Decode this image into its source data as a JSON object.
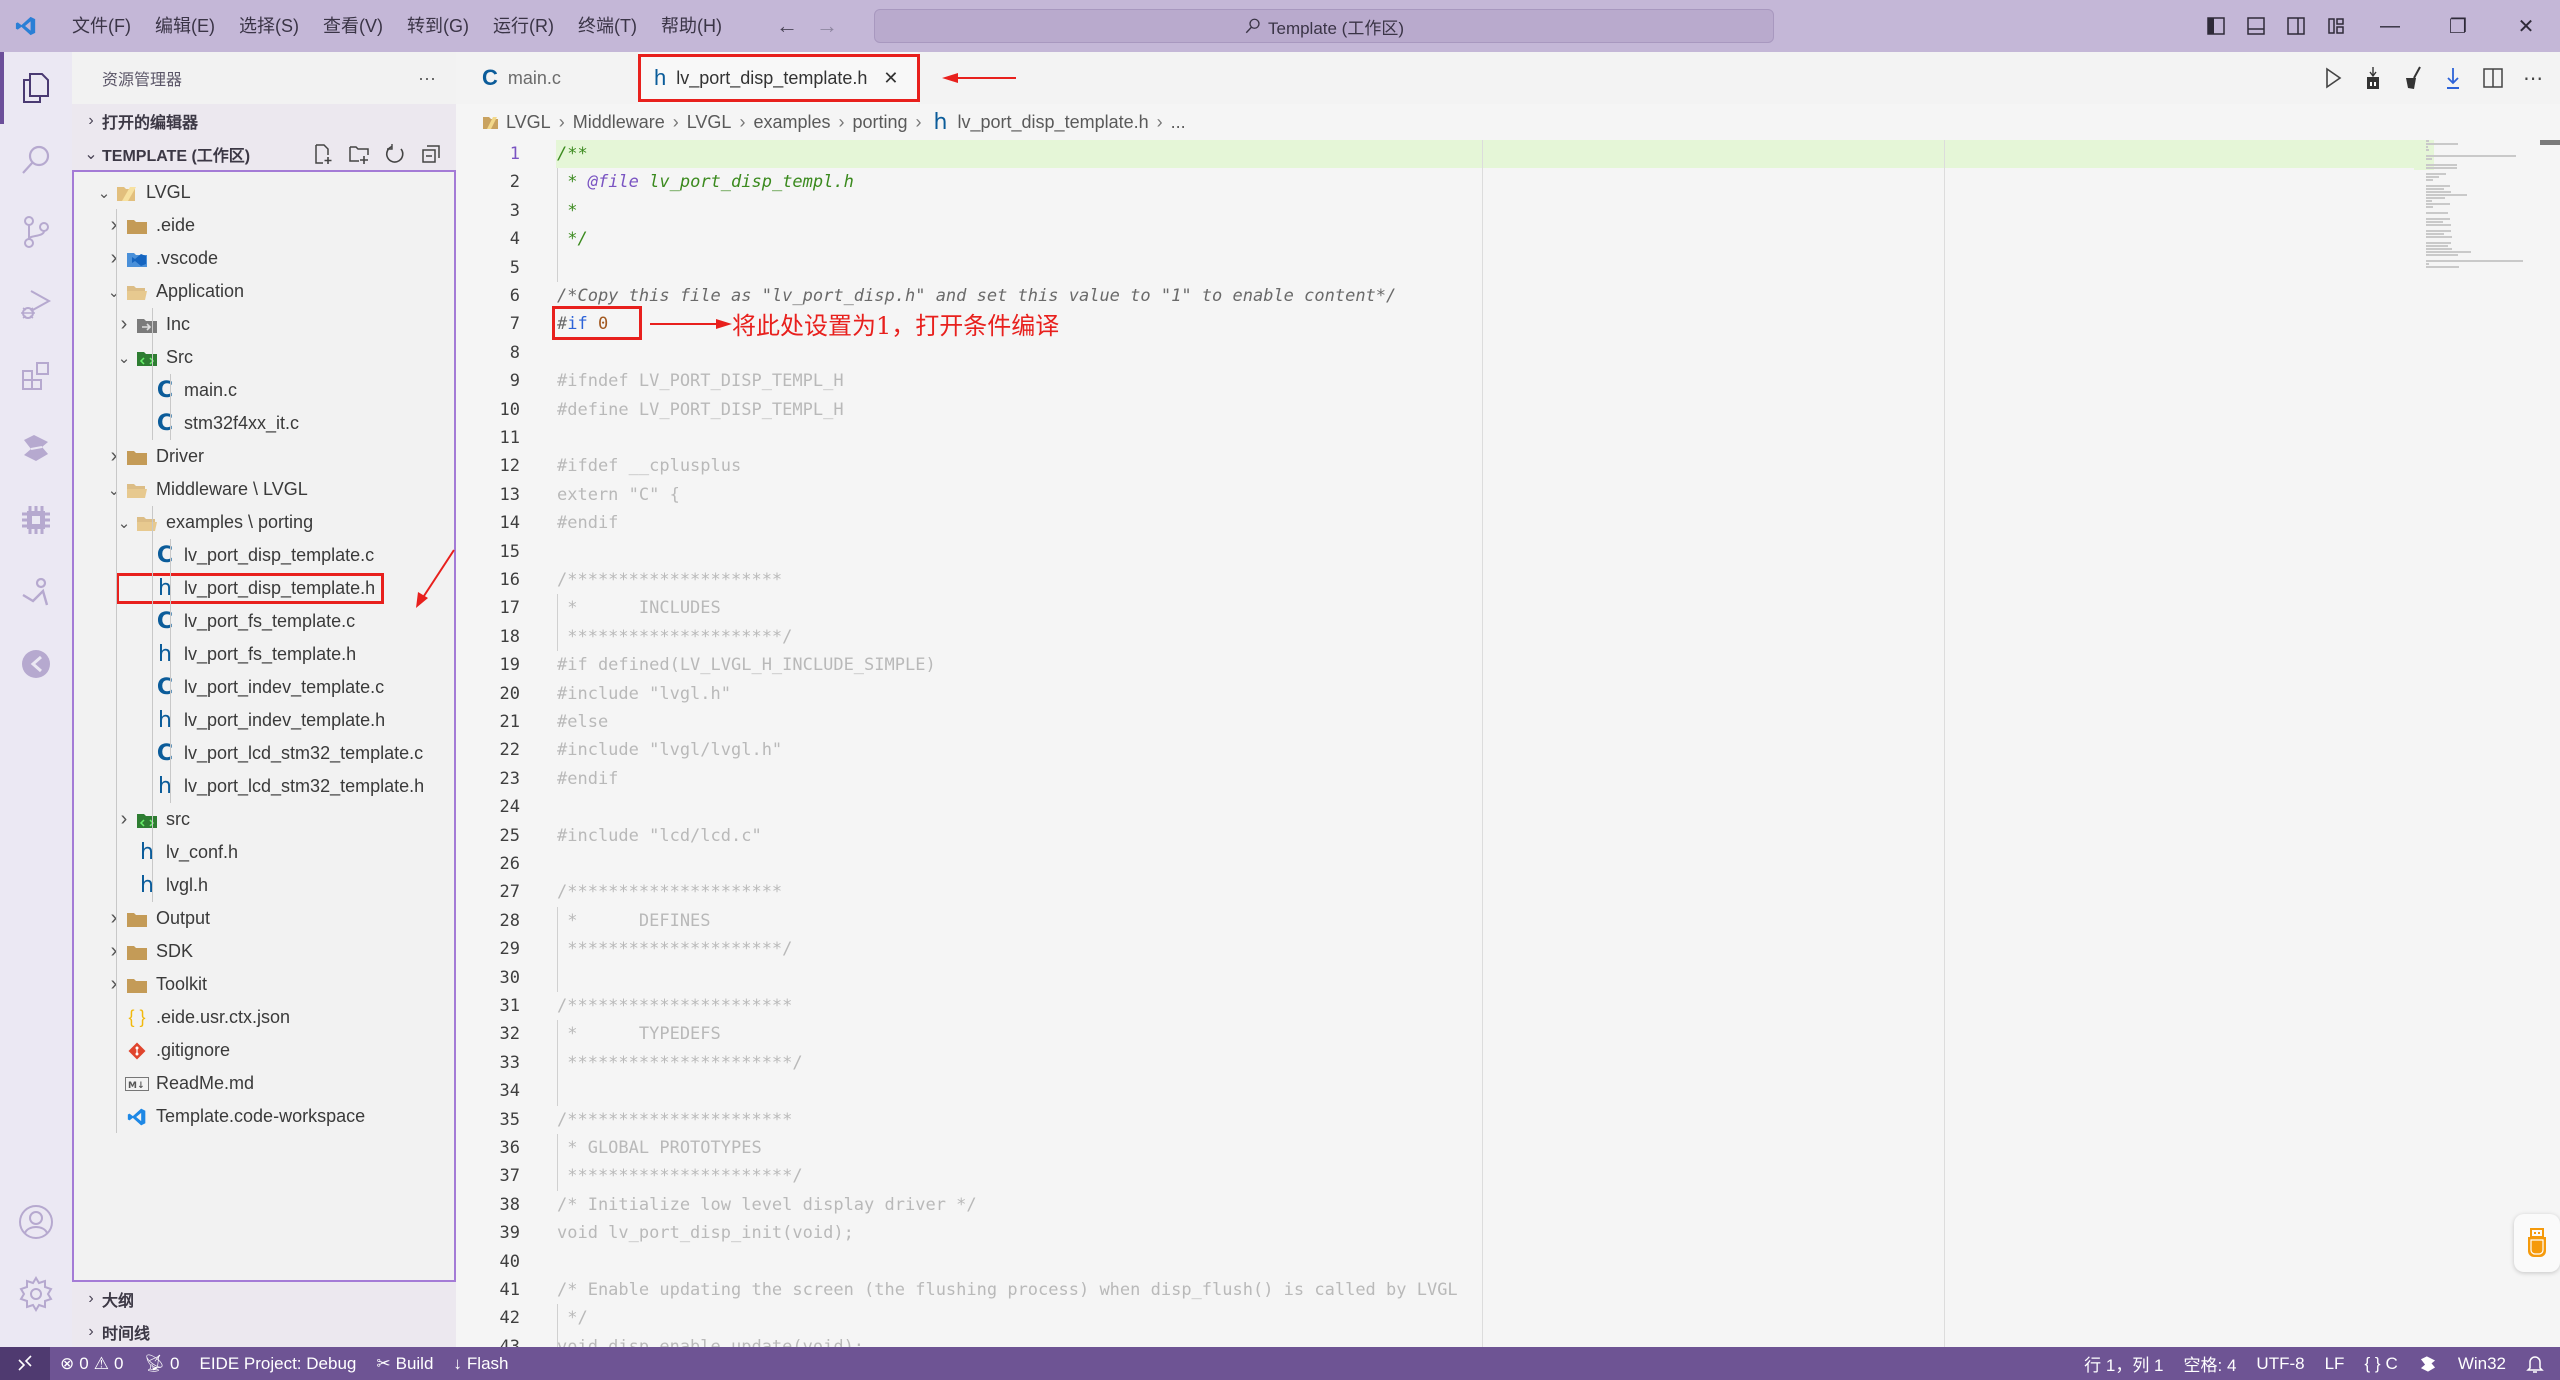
{
  "titlebar": {
    "menu": [
      "文件(F)",
      "编辑(E)",
      "选择(S)",
      "查看(V)",
      "转到(G)",
      "运行(R)",
      "终端(T)",
      "帮助(H)"
    ],
    "command_center": "Template (工作区)",
    "back_glyph": "←",
    "forward_glyph": "→",
    "minimize_glyph": "—",
    "restore_glyph": "❐",
    "close_glyph": "✕"
  },
  "activity_bar": {
    "items": [
      "explorer",
      "search",
      "source-control",
      "run-and-debug",
      "extensions",
      "eide",
      "chip",
      "remote-explorer",
      "codegeex"
    ],
    "bottom": [
      "accounts",
      "manage"
    ]
  },
  "sidebar": {
    "title": "资源管理器",
    "more": "···",
    "open_editors": "打开的编辑器",
    "workspace": "TEMPLATE (工作区)",
    "outline": "大纲",
    "timeline": "时间线",
    "tree": [
      {
        "label": "LVGL",
        "depth": 0,
        "twist": "open",
        "icon": "folder-root"
      },
      {
        "label": ".eide",
        "depth": 1,
        "twist": "closed",
        "icon": "folder"
      },
      {
        "label": ".vscode",
        "depth": 1,
        "twist": "closed",
        "icon": "folder-vscode"
      },
      {
        "label": "Application",
        "depth": 1,
        "twist": "open",
        "icon": "folder-open"
      },
      {
        "label": "Inc",
        "depth": 2,
        "twist": "closed",
        "icon": "folder-include"
      },
      {
        "label": "Src",
        "depth": 2,
        "twist": "open",
        "icon": "folder-src"
      },
      {
        "label": "main.c",
        "depth": 3,
        "twist": "none",
        "icon": "c"
      },
      {
        "label": "stm32f4xx_it.c",
        "depth": 3,
        "twist": "none",
        "icon": "c"
      },
      {
        "label": "Driver",
        "depth": 1,
        "twist": "closed",
        "icon": "folder"
      },
      {
        "label": "Middleware \\ LVGL",
        "depth": 1,
        "twist": "open",
        "icon": "folder-open"
      },
      {
        "label": "examples \\ porting",
        "depth": 2,
        "twist": "open",
        "icon": "folder-open"
      },
      {
        "label": "lv_port_disp_template.c",
        "depth": 3,
        "twist": "none",
        "icon": "c"
      },
      {
        "label": "lv_port_disp_template.h",
        "depth": 3,
        "twist": "none",
        "icon": "h",
        "selected": true
      },
      {
        "label": "lv_port_fs_template.c",
        "depth": 3,
        "twist": "none",
        "icon": "c"
      },
      {
        "label": "lv_port_fs_template.h",
        "depth": 3,
        "twist": "none",
        "icon": "h"
      },
      {
        "label": "lv_port_indev_template.c",
        "depth": 3,
        "twist": "none",
        "icon": "c"
      },
      {
        "label": "lv_port_indev_template.h",
        "depth": 3,
        "twist": "none",
        "icon": "h"
      },
      {
        "label": "lv_port_lcd_stm32_template.c",
        "depth": 3,
        "twist": "none",
        "icon": "c"
      },
      {
        "label": "lv_port_lcd_stm32_template.h",
        "depth": 3,
        "twist": "none",
        "icon": "h"
      },
      {
        "label": "src",
        "depth": 2,
        "twist": "closed",
        "icon": "folder-src"
      },
      {
        "label": "lv_conf.h",
        "depth": 2,
        "twist": "none",
        "icon": "h"
      },
      {
        "label": "lvgl.h",
        "depth": 2,
        "twist": "none",
        "icon": "h"
      },
      {
        "label": "Output",
        "depth": 1,
        "twist": "closed",
        "icon": "folder"
      },
      {
        "label": "SDK",
        "depth": 1,
        "twist": "closed",
        "icon": "folder"
      },
      {
        "label": "Toolkit",
        "depth": 1,
        "twist": "closed",
        "icon": "folder"
      },
      {
        "label": ".eide.usr.ctx.json",
        "depth": 1,
        "twist": "none",
        "icon": "json"
      },
      {
        "label": ".gitignore",
        "depth": 1,
        "twist": "none",
        "icon": "git"
      },
      {
        "label": "ReadMe.md",
        "depth": 1,
        "twist": "none",
        "icon": "markdown"
      },
      {
        "label": "Template.code-workspace",
        "depth": 1,
        "twist": "none",
        "icon": "vscode"
      }
    ]
  },
  "tabs": [
    {
      "label": "main.c",
      "icon": "C",
      "active": false
    },
    {
      "label": "lv_port_disp_template.h",
      "icon": "h",
      "active": true,
      "close": "✕"
    }
  ],
  "breadcrumb": [
    "LVGL",
    "Middleware",
    "LVGL",
    "examples",
    "porting",
    "lv_port_disp_template.h",
    "..."
  ],
  "breadcrumb_sep": "›",
  "editor": {
    "current_line": 1,
    "lines": [
      {
        "n": 1,
        "segs": [
          {
            "t": "/**",
            "c": "c-green"
          }
        ]
      },
      {
        "n": 2,
        "segs": [
          {
            "t": " * ",
            "c": "c-green"
          },
          {
            "t": "@file",
            "c": "c-tag"
          },
          {
            "t": " lv_port_disp_templ.h",
            "c": "c-green"
          }
        ]
      },
      {
        "n": 3,
        "segs": [
          {
            "t": " *",
            "c": "c-green"
          }
        ]
      },
      {
        "n": 4,
        "segs": [
          {
            "t": " */",
            "c": "c-green"
          }
        ]
      },
      {
        "n": 5,
        "segs": []
      },
      {
        "n": 6,
        "segs": [
          {
            "t": "/*Copy this file as \"lv_port_disp.h\" and set this value to \"1\" to enable content*/",
            "c": "c-comment"
          }
        ]
      },
      {
        "n": 7,
        "segs": [
          {
            "t": "#",
            "c": "c-comment"
          },
          {
            "t": "if",
            "c": "c-kw"
          },
          {
            "t": " ",
            "c": "c-dim"
          },
          {
            "t": "0",
            "c": "c-num"
          }
        ]
      },
      {
        "n": 8,
        "segs": []
      },
      {
        "n": 9,
        "segs": [
          {
            "t": "#ifndef LV_PORT_DISP_TEMPL_H",
            "c": "c-dim"
          }
        ]
      },
      {
        "n": 10,
        "segs": [
          {
            "t": "#define LV_PORT_DISP_TEMPL_H",
            "c": "c-dim"
          }
        ]
      },
      {
        "n": 11,
        "segs": []
      },
      {
        "n": 12,
        "segs": [
          {
            "t": "#ifdef __cplusplus",
            "c": "c-dim"
          }
        ]
      },
      {
        "n": 13,
        "segs": [
          {
            "t": "extern \"C\" {",
            "c": "c-dim"
          }
        ]
      },
      {
        "n": 14,
        "segs": [
          {
            "t": "#endif",
            "c": "c-dim"
          }
        ]
      },
      {
        "n": 15,
        "segs": []
      },
      {
        "n": 16,
        "segs": [
          {
            "t": "/*********************",
            "c": "c-dim"
          }
        ]
      },
      {
        "n": 17,
        "segs": [
          {
            "t": " *      INCLUDES",
            "c": "c-dim"
          }
        ]
      },
      {
        "n": 18,
        "segs": [
          {
            "t": " *********************/",
            "c": "c-dim"
          }
        ]
      },
      {
        "n": 19,
        "segs": [
          {
            "t": "#if defined(LV_LVGL_H_INCLUDE_SIMPLE)",
            "c": "c-dim"
          }
        ]
      },
      {
        "n": 20,
        "segs": [
          {
            "t": "#include \"lvgl.h\"",
            "c": "c-dim"
          }
        ]
      },
      {
        "n": 21,
        "segs": [
          {
            "t": "#else",
            "c": "c-dim"
          }
        ]
      },
      {
        "n": 22,
        "segs": [
          {
            "t": "#include \"lvgl/lvgl.h\"",
            "c": "c-dim"
          }
        ]
      },
      {
        "n": 23,
        "segs": [
          {
            "t": "#endif",
            "c": "c-dim"
          }
        ]
      },
      {
        "n": 24,
        "segs": []
      },
      {
        "n": 25,
        "segs": [
          {
            "t": "#include \"lcd/lcd.c\"",
            "c": "c-dim"
          }
        ]
      },
      {
        "n": 26,
        "segs": []
      },
      {
        "n": 27,
        "segs": [
          {
            "t": "/*********************",
            "c": "c-dim"
          }
        ]
      },
      {
        "n": 28,
        "segs": [
          {
            "t": " *      DEFINES",
            "c": "c-dim"
          }
        ]
      },
      {
        "n": 29,
        "segs": [
          {
            "t": " *********************/",
            "c": "c-dim"
          }
        ]
      },
      {
        "n": 30,
        "segs": []
      },
      {
        "n": 31,
        "segs": [
          {
            "t": "/**********************",
            "c": "c-dim"
          }
        ]
      },
      {
        "n": 32,
        "segs": [
          {
            "t": " *      TYPEDEFS",
            "c": "c-dim"
          }
        ]
      },
      {
        "n": 33,
        "segs": [
          {
            "t": " **********************/",
            "c": "c-dim"
          }
        ]
      },
      {
        "n": 34,
        "segs": []
      },
      {
        "n": 35,
        "segs": [
          {
            "t": "/**********************",
            "c": "c-dim"
          }
        ]
      },
      {
        "n": 36,
        "segs": [
          {
            "t": " * GLOBAL PROTOTYPES",
            "c": "c-dim"
          }
        ]
      },
      {
        "n": 37,
        "segs": [
          {
            "t": " **********************/",
            "c": "c-dim"
          }
        ]
      },
      {
        "n": 38,
        "segs": [
          {
            "t": "/* Initialize low level display driver */",
            "c": "c-dim"
          }
        ]
      },
      {
        "n": 39,
        "segs": [
          {
            "t": "void lv_port_disp_init(void);",
            "c": "c-dim"
          }
        ]
      },
      {
        "n": 40,
        "segs": []
      },
      {
        "n": 41,
        "segs": [
          {
            "t": "/* Enable updating the screen (the flushing process) when disp_flush() is called by LVGL",
            "c": "c-dim"
          }
        ]
      },
      {
        "n": 42,
        "segs": [
          {
            "t": " */",
            "c": "c-dim"
          }
        ]
      },
      {
        "n": 43,
        "segs": [
          {
            "t": "void disp_enable_update(void);",
            "c": "c-dim"
          }
        ]
      }
    ]
  },
  "annotation": {
    "note": "将此处设置为1，打开条件编译",
    "color": "#e8201d"
  },
  "statusbar": {
    "errors": "0",
    "warnings": "0",
    "ports": "0",
    "project": "EIDE Project: Debug",
    "build": "Build",
    "flash": "Flash",
    "position": "行 1，列 1",
    "spaces": "空格: 4",
    "encoding": "UTF-8",
    "eol": "LF",
    "language": "C",
    "platform": "Win32"
  },
  "colors": {
    "titlebar": "#c4b7d7",
    "statusbar": "#6e5494",
    "accent": "#a47bd6",
    "highlight_line": "#e5f6d7",
    "icon_c": "#0b5c9a"
  }
}
